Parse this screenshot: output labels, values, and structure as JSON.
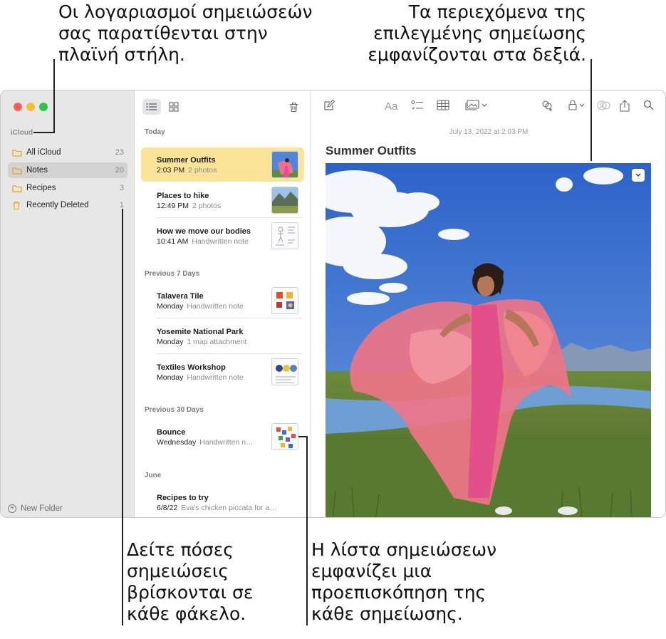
{
  "callouts": {
    "top_left": [
      "Οι λογαριασμοί σημειώσεών",
      "σας παρατίθενται στην",
      "πλαϊνή στήλη."
    ],
    "top_right": [
      "Τα περιεχόμενα της",
      "επιλεγμένης σημείωσης",
      "εμφανίζονται στα δεξιά."
    ],
    "bottom_left": [
      "Δείτε πόσες",
      "σημειώσεις",
      "βρίσκονται σε",
      "κάθε φάκελο."
    ],
    "bottom_right": [
      "Η λίστα σημειώσεων",
      "εμφανίζει μια",
      "προεπισκόπηση της",
      "κάθε σημείωσης."
    ]
  },
  "sidebar": {
    "section": "iCloud",
    "folders": [
      {
        "name": "All iCloud",
        "count": "23",
        "icon": "folder-icon"
      },
      {
        "name": "Notes",
        "count": "20",
        "icon": "folder-icon",
        "selected": true
      },
      {
        "name": "Recipes",
        "count": "3",
        "icon": "folder-icon"
      },
      {
        "name": "Recently Deleted",
        "count": "1",
        "icon": "trash-icon"
      }
    ],
    "new_folder": "New Folder"
  },
  "notelist": {
    "groups": [
      "Today",
      "Previous 7 Days",
      "Previous 30 Days",
      "June"
    ],
    "notes": [
      {
        "title": "Summer Outfits",
        "date": "2:03 PM",
        "preview": "2 photos",
        "thumb": "photo-thumb-pink"
      },
      {
        "title": "Places to hike",
        "date": "12:49 PM",
        "preview": "2 photos",
        "thumb": "photo-thumb-landscape"
      },
      {
        "title": "How we move our bodies",
        "date": "10:41 AM",
        "preview": "Handwritten note",
        "thumb": "sketch-thumb"
      },
      {
        "title": "Talavera Tile",
        "date": "Monday",
        "preview": "Handwritten note",
        "thumb": "tile-thumb"
      },
      {
        "title": "Yosemite National Park",
        "date": "Monday",
        "preview": "1 map attachment",
        "thumb": ""
      },
      {
        "title": "Textiles Workshop",
        "date": "Monday",
        "preview": "Handwritten note",
        "thumb": "textile-thumb"
      },
      {
        "title": "Bounce",
        "date": "Wednesday",
        "preview": "Handwritten n…",
        "thumb": "bounce-thumb"
      },
      {
        "title": "Recipes to try",
        "date": "6/8/22",
        "preview": "Eva's chicken piccata for a…",
        "thumb": ""
      }
    ]
  },
  "editor": {
    "timestamp": "July 13, 2022 at 2:03 PM",
    "title": "Summer Outfits",
    "format_label": "Aa"
  },
  "colors": {
    "selected_note": "#fbe398",
    "folder_accent": "#e6a817",
    "sidebar_bg": "#e8e7e8"
  }
}
